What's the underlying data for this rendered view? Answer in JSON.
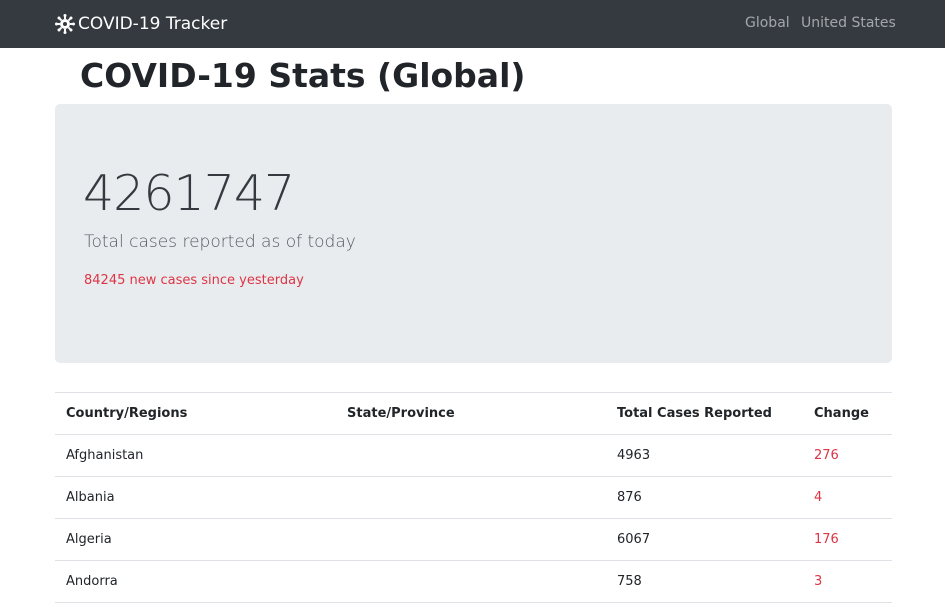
{
  "navbar": {
    "brand_label": "COVID-19 Tracker",
    "brand_icon": "virus-icon",
    "links": [
      "Global",
      "United States"
    ]
  },
  "page": {
    "title": "COVID-19 Stats (Global)"
  },
  "summary": {
    "total_cases": "4261747",
    "total_caption": "Total cases reported as of today",
    "new_cases_text": "84245 new cases since yesterday"
  },
  "table": {
    "headers": [
      "Country/Regions",
      "State/Province",
      "Total Cases Reported",
      "Change"
    ],
    "rows": [
      {
        "country": "Afghanistan",
        "state": "",
        "total": "4963",
        "change": "276"
      },
      {
        "country": "Albania",
        "state": "",
        "total": "876",
        "change": "4"
      },
      {
        "country": "Algeria",
        "state": "",
        "total": "6067",
        "change": "176"
      },
      {
        "country": "Andorra",
        "state": "",
        "total": "758",
        "change": "3"
      }
    ]
  },
  "colors": {
    "navbar_bg": "#343a40",
    "jumbotron_bg": "#e9ecef",
    "change_red": "#dc3545"
  }
}
